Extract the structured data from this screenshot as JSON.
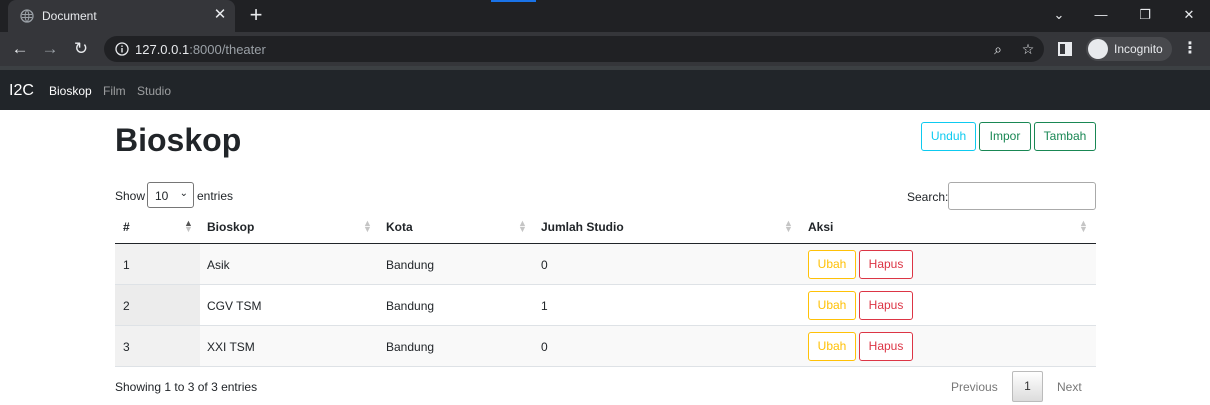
{
  "browser": {
    "tab_title": "Document",
    "url_host": "127.0.0.1",
    "url_rest": ":8000/theater",
    "profile_label": "Incognito",
    "accent_color": "#1a73e8"
  },
  "navbar": {
    "brand": "I2C",
    "links": [
      "Bioskop",
      "Film",
      "Studio"
    ],
    "active_link": "Bioskop"
  },
  "page": {
    "title": "Bioskop",
    "actions": {
      "download": "Unduh",
      "import": "Impor",
      "add": "Tambah"
    }
  },
  "table_controls": {
    "show_label": "Show",
    "page_length": "10",
    "entries_label": "entries",
    "search_label": "Search:",
    "search_value": ""
  },
  "table": {
    "columns": [
      "#",
      "Bioskop",
      "Kota",
      "Jumlah Studio",
      "Aksi"
    ],
    "sorted_column": "#",
    "sort_direction": "asc",
    "rows": [
      {
        "no": "1",
        "bioskop": "Asik",
        "kota": "Bandung",
        "jumlah_studio": "0"
      },
      {
        "no": "2",
        "bioskop": "CGV TSM",
        "kota": "Bandung",
        "jumlah_studio": "1"
      },
      {
        "no": "3",
        "bioskop": "XXI TSM",
        "kota": "Bandung",
        "jumlah_studio": "0"
      }
    ],
    "row_actions": {
      "edit": "Ubah",
      "delete": "Hapus"
    }
  },
  "footer": {
    "info": "Showing 1 to 3 of 3 entries",
    "previous": "Previous",
    "current_page": "1",
    "next": "Next"
  },
  "colors": {
    "info": "#0dcaf0",
    "success": "#198754",
    "warning": "#ffc107",
    "danger": "#dc3545",
    "navbar": "#212529"
  }
}
